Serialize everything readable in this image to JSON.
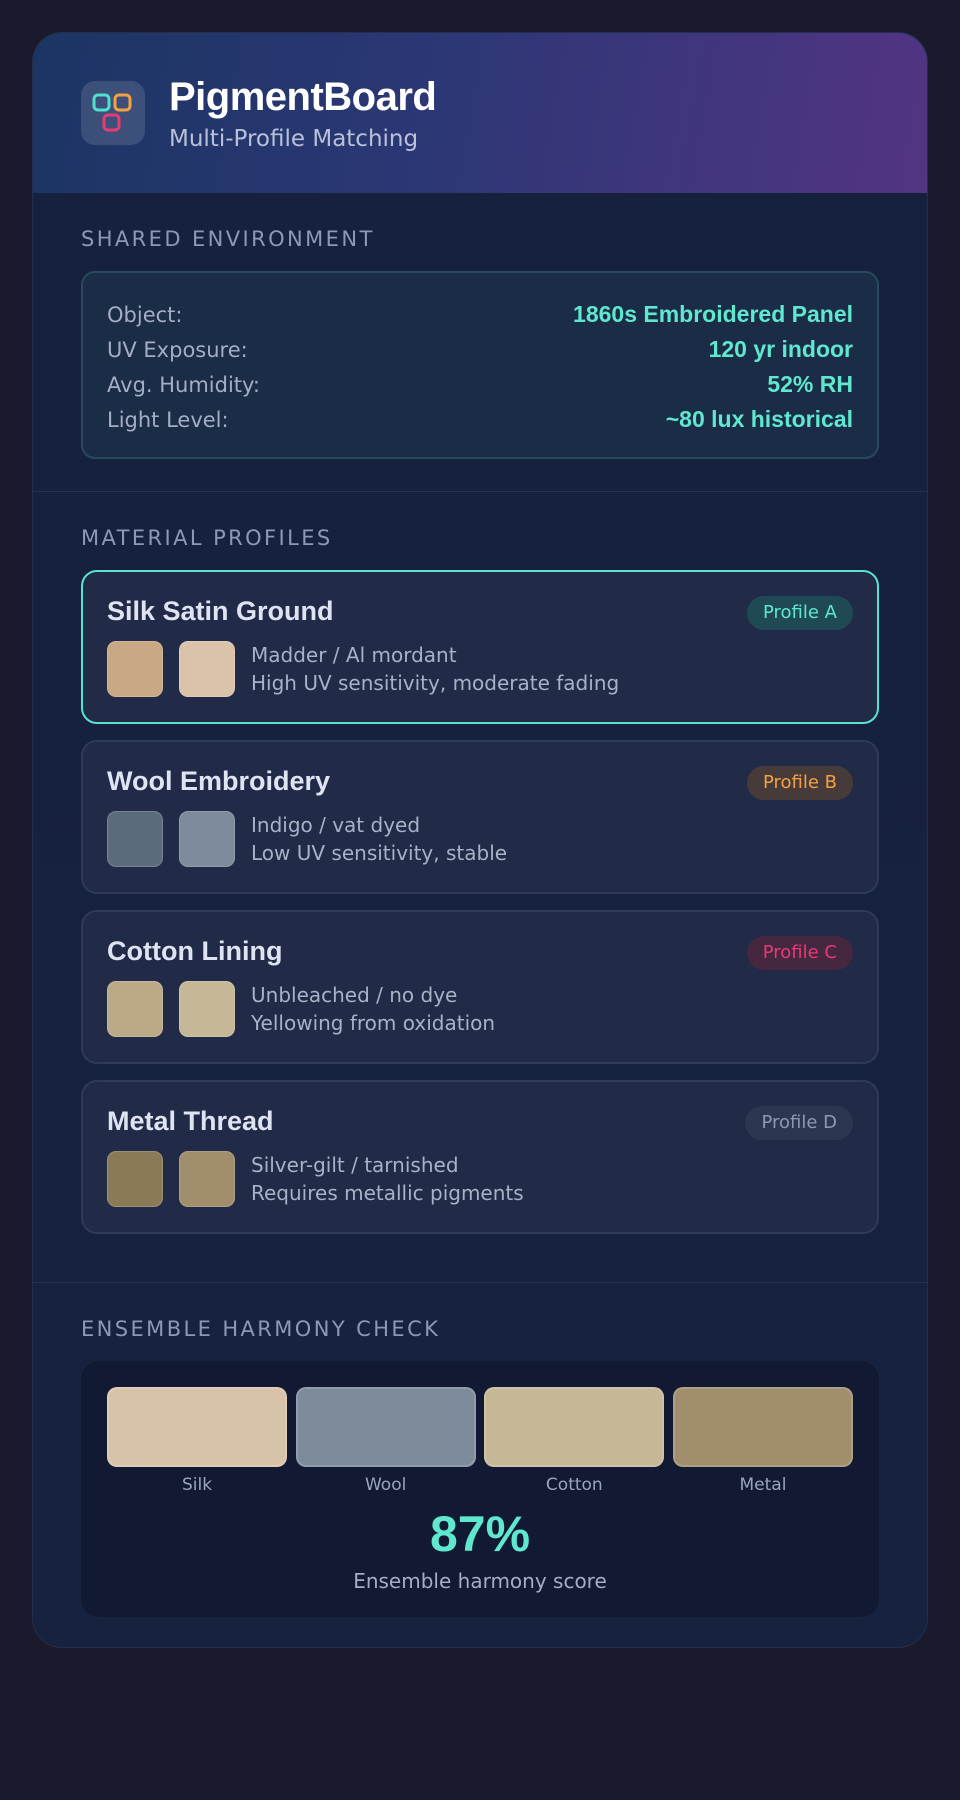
{
  "header": {
    "title": "PigmentBoard",
    "subtitle": "Multi-Profile Matching"
  },
  "environment": {
    "section_title": "SHARED ENVIRONMENT",
    "rows": [
      {
        "label": "Object:",
        "value": "1860s Embroidered Panel"
      },
      {
        "label": "UV Exposure:",
        "value": "120 yr indoor"
      },
      {
        "label": "Avg. Humidity:",
        "value": "52% RH"
      },
      {
        "label": "Light Level:",
        "value": "~80 lux historical"
      }
    ]
  },
  "profiles": {
    "section_title": "MATERIAL PROFILES",
    "items": [
      {
        "name": "Silk Satin Ground",
        "badge": "Profile A",
        "badge_color": "#5fe8cf",
        "badge_bg": "#1f4a55",
        "active": true,
        "swatch1": "#c9a984",
        "swatch2": "#dac3a8",
        "line1": "Madder / Al mordant",
        "line2": "High UV sensitivity, moderate fading"
      },
      {
        "name": "Wool Embroidery",
        "badge": "Profile B",
        "badge_color": "#f5a142",
        "badge_bg": "#473b3a",
        "active": false,
        "swatch1": "#5c6b7c",
        "swatch2": "#7e8b9c",
        "line1": "Indigo / vat dyed",
        "line2": "Low UV sensitivity, stable"
      },
      {
        "name": "Cotton Lining",
        "badge": "Profile C",
        "badge_color": "#e83a73",
        "badge_bg": "#45273f",
        "active": false,
        "swatch1": "#bba987",
        "swatch2": "#c6b896",
        "line1": "Unbleached / no dye",
        "line2": "Yellowing from oxidation"
      },
      {
        "name": "Metal Thread",
        "badge": "Profile D",
        "badge_color": "#8f98b0",
        "badge_bg": "#2d3650",
        "active": false,
        "swatch1": "#8b7a57",
        "swatch2": "#a08e6c",
        "line1": "Silver-gilt / tarnished",
        "line2": "Requires metallic pigments"
      }
    ]
  },
  "harmony": {
    "section_title": "ENSEMBLE HARMONY CHECK",
    "swatches": [
      {
        "label": "Silk",
        "color": "#d9c3a8"
      },
      {
        "label": "Wool",
        "color": "#7e8b9b"
      },
      {
        "label": "Cotton",
        "color": "#c5b897"
      },
      {
        "label": "Metal",
        "color": "#a08e6c"
      }
    ],
    "score": "87%",
    "score_label": "Ensemble harmony score"
  },
  "colors": {
    "accent": "#5fe8cf",
    "logo_teal": "#4fe0cc",
    "logo_orange": "#f5a142",
    "logo_pink": "#e83a73"
  }
}
